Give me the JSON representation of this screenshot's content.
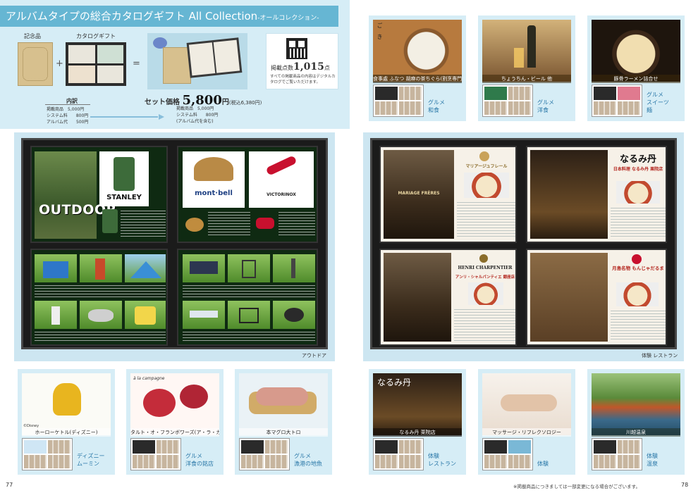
{
  "header": {
    "title": "アルバムタイプの総合カタログギフト All Collection",
    "title_sub": "-オールコレクション-",
    "memorial_label": "記念品",
    "catalog_label": "カタログギフト",
    "plus": "+",
    "equals": "=",
    "qr_count_label": "掲載点数",
    "qr_count": "1,015",
    "qr_count_unit": "点",
    "qr_note": "すべての掲載商品の内容はデジタルカタログでご覧いただけます。",
    "breakdown_title": "内訳",
    "breakdown": [
      {
        "label": "掲載商品",
        "value": "5,000円"
      },
      {
        "label": "システム料",
        "value": "800円"
      },
      {
        "label": "アルバム代",
        "value": "500円"
      }
    ],
    "price_label": "セット価格",
    "price": "5,800",
    "price_unit": "円",
    "price_tax": "(税込6,380円)",
    "price_breakdown": [
      {
        "label": "掲載商品",
        "value": "5,000円"
      },
      {
        "label": "システム料",
        "value": "800円"
      },
      {
        "label": "(アルバム代を含む)",
        "value": ""
      }
    ]
  },
  "left_spread": {
    "outdoor_title": "OUTDOOR",
    "brand_stanley": "STANLEY",
    "brand_montbell": "mont·bell",
    "brand_victorinox": "VICTORINOX",
    "category": "アウトドア"
  },
  "right_spread": {
    "naru_logo": "なるみ丹",
    "naru_sub": "日本料理 なるみ丹 栗院店",
    "mariage_title": "マリアージュフレール",
    "mariage_sign": "MARIAGE FRÈRES",
    "henri_title": "HENRI CHARPENTIER",
    "henri_sub": "アンリ・シャルパンティエ 銀座店",
    "tsukimi": "月島名物 もんじゃだるま",
    "category": "体験 レストラン"
  },
  "top_cards": [
    {
      "photo_label": "食事處 ふなつ 胡麻の茶ちぐら(割烹専門所)",
      "category": "グルメ\n和食",
      "side_text": "ご　き",
      "colors": [
        "#f3efe4",
        "#8a5a2e"
      ]
    },
    {
      "photo_label": "ちょうちん・ビール 他",
      "category": "グルメ\n洋食",
      "colors": [
        "#c8a66a",
        "#6a4b28"
      ]
    },
    {
      "photo_label": "豚骨ラーメン詰合せ",
      "category": "グルメ\nスイーツ\n麺",
      "colors": [
        "#e6d3a8",
        "#5a3a22"
      ]
    }
  ],
  "bottom_cards_left": [
    {
      "photo_label": "ホーローケトル(ディズニー)",
      "category": "ディズニー\nムーミン",
      "brand": "©Disney",
      "colors": [
        "#fbfbf6",
        "#e8b51f"
      ]
    },
    {
      "photo_label": "タルト・オ・フランボワーズ(ア・ラ・カンパーニュ)",
      "category": "グルメ\n洋食の銘店",
      "brand": "à la campagne",
      "colors": [
        "#fff7f4",
        "#c42c3a"
      ]
    },
    {
      "photo_label": "本マグロ大トロ",
      "category": "グルメ\n漁港の地魚",
      "colors": [
        "#eaf2f6",
        "#d79a8c"
      ]
    }
  ],
  "bottom_cards_right": [
    {
      "photo_label": "なるみ丹 栗院店",
      "category": "体験\nレストラン",
      "logo": "なるみ丹",
      "colors": [
        "#2a1f12",
        "#a87b3a"
      ]
    },
    {
      "photo_label": "マッサージ・リフレクソロジー",
      "category": "体験",
      "colors": [
        "#f6efe6",
        "#e2c3a8"
      ]
    },
    {
      "photo_label": "川越温泉",
      "category": "体験\n温泉",
      "colors": [
        "#5a8a3a",
        "#c0572a"
      ]
    }
  ],
  "footer": {
    "left_page": "77",
    "right_page": "78",
    "note": "※掲載商品につきましては一部変更になる場合がございます。"
  }
}
